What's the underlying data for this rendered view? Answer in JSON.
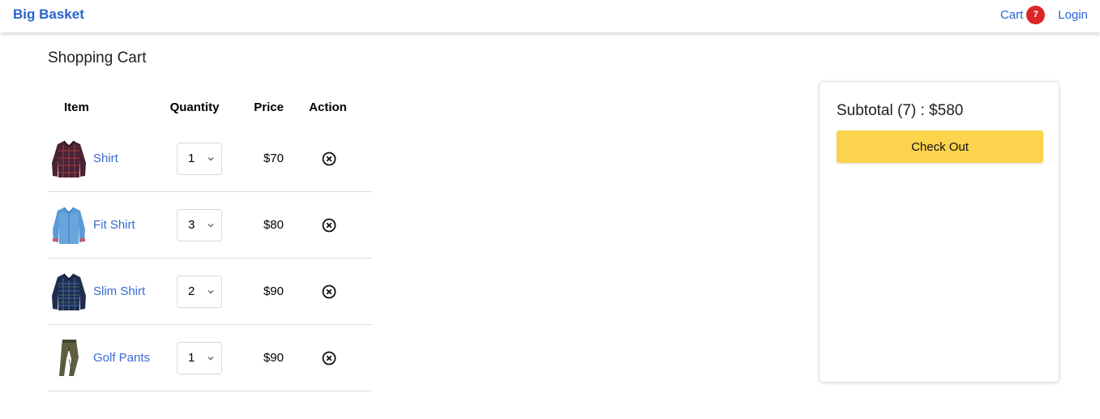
{
  "navbar": {
    "brand": "Big Basket",
    "cart_label": "Cart",
    "cart_count": "7",
    "login_label": "Login"
  },
  "page": {
    "title": "Shopping Cart"
  },
  "table": {
    "headers": {
      "item": "Item",
      "quantity": "Quantity",
      "price": "Price",
      "action": "Action"
    },
    "rows": [
      {
        "name": "Shirt",
        "qty": "1",
        "price": "$70",
        "image": "plaid-shirt-red"
      },
      {
        "name": "Fit Shirt",
        "qty": "3",
        "price": "$80",
        "image": "denim-shirt"
      },
      {
        "name": "Slim Shirt",
        "qty": "2",
        "price": "$90",
        "image": "plaid-shirt-navy"
      },
      {
        "name": "Golf Pants",
        "qty": "1",
        "price": "$90",
        "image": "olive-pants"
      }
    ]
  },
  "summary": {
    "subtotal": "Subtotal (7) : $580",
    "checkout_label": "Check Out"
  },
  "colors": {
    "brand": "#2a64cf",
    "badge": "#dc2626",
    "checkout": "#fcd34d"
  },
  "icons": {
    "remove": "close-circle-icon",
    "dropdown": "chevron-down-icon"
  }
}
